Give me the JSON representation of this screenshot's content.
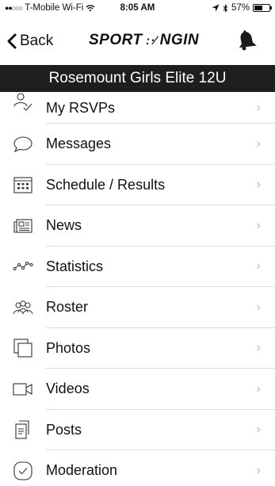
{
  "status_bar": {
    "signal_dots": "●●○○○",
    "carrier": "T-Mobile Wi-Fi",
    "wifi_icon": "wifi-icon",
    "time": "8:05 AM",
    "battery_percent": "57%",
    "battery_level": 0.57
  },
  "nav": {
    "back_label": "Back",
    "logo_text_left": "SPORT",
    "logo_text_right": "NGIN",
    "bell_icon": "bell-icon"
  },
  "team": {
    "name": "Rosemount Girls Elite 12U"
  },
  "menu": [
    {
      "label": "My RSVPs",
      "icon": "rsvp-people-icon"
    },
    {
      "label": "Messages",
      "icon": "speech-bubble-icon"
    },
    {
      "label": "Schedule / Results",
      "icon": "calendar-icon"
    },
    {
      "label": "News",
      "icon": "newspaper-icon"
    },
    {
      "label": "Statistics",
      "icon": "line-graph-icon"
    },
    {
      "label": "Roster",
      "icon": "group-icon"
    },
    {
      "label": "Photos",
      "icon": "photos-icon"
    },
    {
      "label": "Videos",
      "icon": "video-camera-icon"
    },
    {
      "label": "Posts",
      "icon": "posts-icon"
    },
    {
      "label": "Moderation",
      "icon": "check-circle-icon"
    }
  ],
  "chevron": "›",
  "colors": {
    "banner_bg": "#1e1e1e",
    "divider": "#dcdcdc",
    "chevron": "#b8b8b8"
  }
}
